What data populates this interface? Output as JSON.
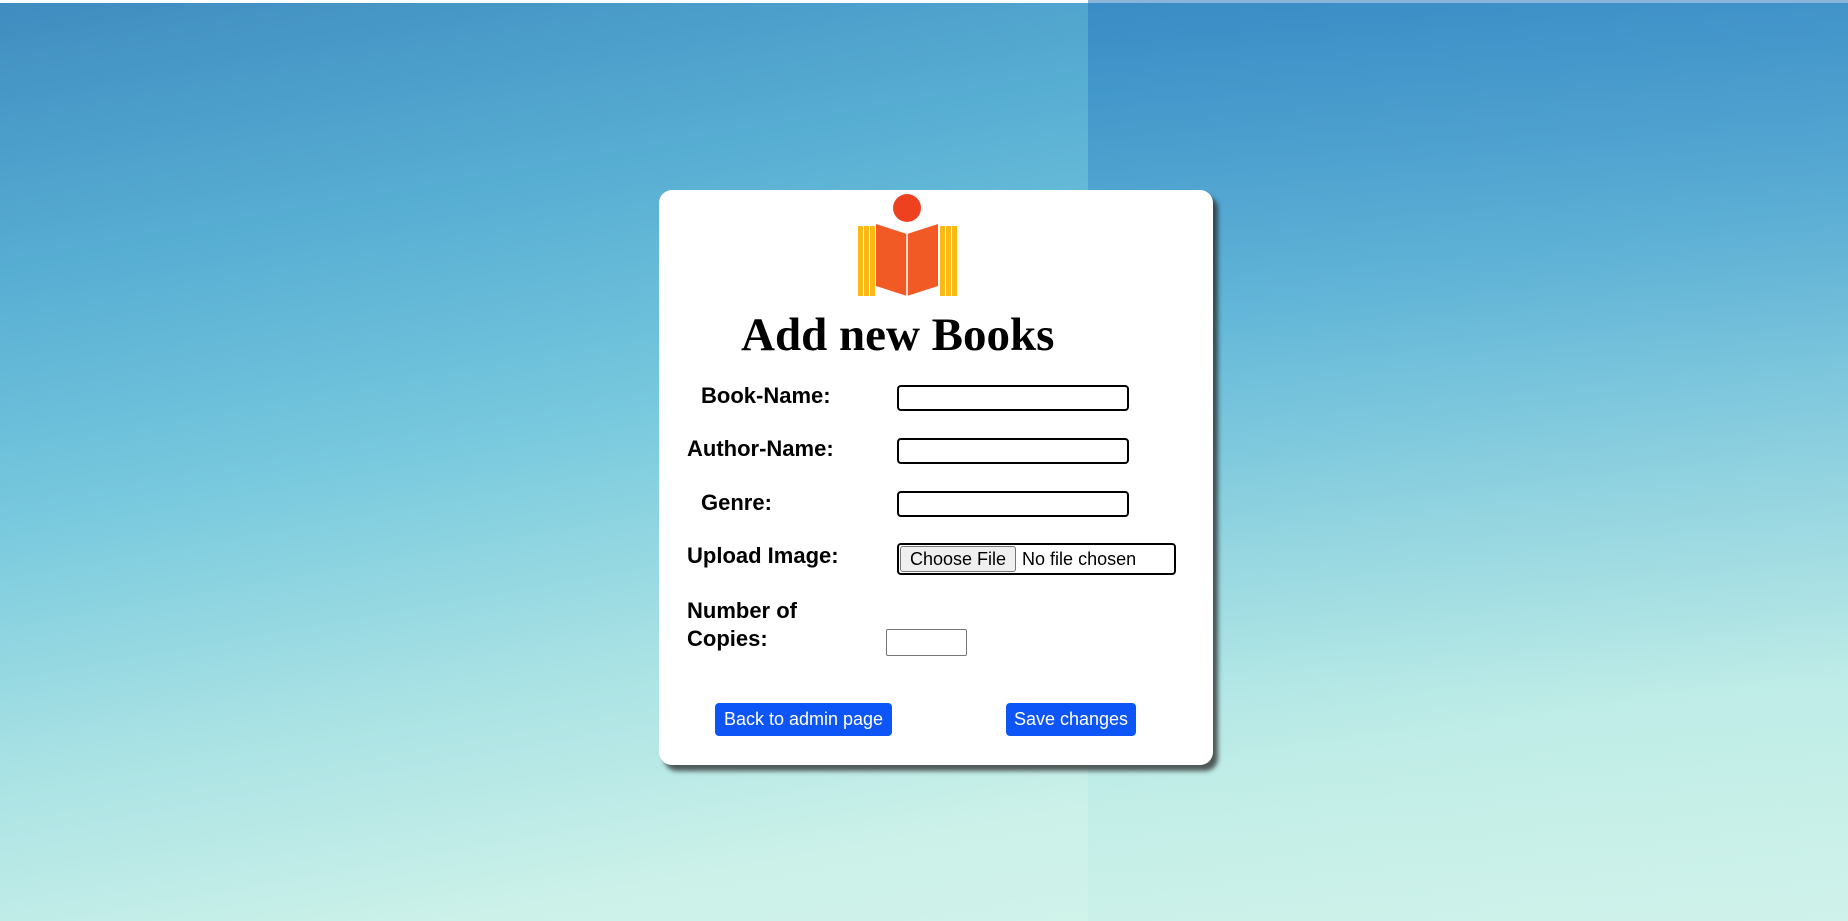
{
  "form": {
    "title": "Add new Books",
    "fields": {
      "book_name": {
        "label": "Book-Name:",
        "value": ""
      },
      "author_name": {
        "label": "Author-Name:",
        "value": ""
      },
      "genre": {
        "label": "Genre:",
        "value": ""
      },
      "upload_image": {
        "label": "Upload Image:",
        "button_label": "Choose File",
        "status": "No file chosen"
      },
      "copies": {
        "label_line1": "Number of",
        "label_line2": "Copies:",
        "value": ""
      }
    },
    "buttons": {
      "back": "Back to admin page",
      "save": "Save changes"
    }
  },
  "colors": {
    "accent_button": "#0d55f6",
    "logo_orange": "#f15a24",
    "logo_yellow": "#fbb917",
    "logo_red_dot": "#ee4122"
  },
  "icons": {
    "logo": "open-book-reader-logo"
  }
}
